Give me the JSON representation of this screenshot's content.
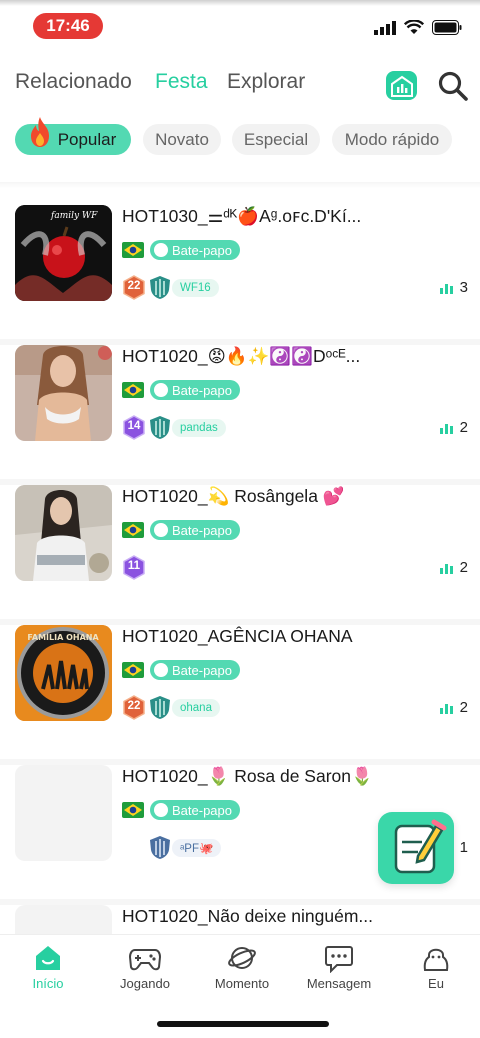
{
  "status_bar": {
    "time": "17:46"
  },
  "top_nav": {
    "tabs": [
      {
        "label": "Relacionado"
      },
      {
        "label": "Festa"
      },
      {
        "label": "Explorar"
      }
    ],
    "active_tab": "Festa"
  },
  "filters": {
    "chips": [
      {
        "label": "Popular"
      },
      {
        "label": "Novato"
      },
      {
        "label": "Especial"
      },
      {
        "label": "Modo rápido"
      }
    ],
    "active": "Popular"
  },
  "rooms": [
    {
      "title": "HOT1030_⚌ᵈᴷ🍎Aᵍ.ᴏꜰᴄ.D'Kí...",
      "tag": "Bate-papo",
      "level": "22",
      "level_color": "#e0623a",
      "family": "WF16",
      "listeners": "3",
      "avatar_caption": "family WF"
    },
    {
      "title": "HOT1020_😡🔥✨☯️☯️Dᵒᶜᴱ...",
      "tag": "Bate-papo",
      "level": "14",
      "level_color": "#8a52e0",
      "family": "pandas",
      "listeners": "2",
      "avatar_caption": ""
    },
    {
      "title": "HOT1020_💫 Rosângela 💕",
      "tag": "Bate-papo",
      "level": "11",
      "level_color": "#8a52e0",
      "family": "",
      "listeners": "2",
      "avatar_caption": ""
    },
    {
      "title": "HOT1020_AGÊNCIA OHANA",
      "tag": "Bate-papo",
      "level": "22",
      "level_color": "#e0623a",
      "family": "ohana",
      "listeners": "2",
      "avatar_caption": "FAMÍLIA OHANA"
    },
    {
      "title": "HOT1020_🌷 Rosa de Saron🌷",
      "tag": "Bate-papo",
      "level": "",
      "level_color": "#8a52e0",
      "family": "ᵃPF🐙",
      "listeners": "1",
      "avatar_caption": ""
    },
    {
      "title": "HOT1020_Não deixe ninguém...",
      "tag": "",
      "level": "",
      "level_color": "",
      "family": "",
      "listeners": "",
      "avatar_caption": ""
    }
  ],
  "bottom_nav": {
    "items": [
      {
        "label": "Início",
        "icon": "home-icon"
      },
      {
        "label": "Jogando",
        "icon": "gamepad-icon"
      },
      {
        "label": "Momento",
        "icon": "planet-icon"
      },
      {
        "label": "Mensagem",
        "icon": "message-icon"
      },
      {
        "label": "Eu",
        "icon": "profile-icon"
      }
    ],
    "active": "Início"
  },
  "colors": {
    "accent": "#27cfa0",
    "chip_active": "#53d9b2",
    "time_pill": "#e53935"
  }
}
